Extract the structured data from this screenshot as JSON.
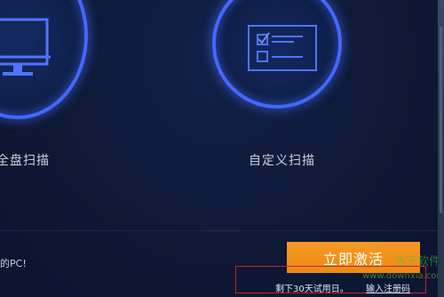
{
  "scan_options": [
    {
      "label": "全盘扫描",
      "icon": "monitor-icon"
    },
    {
      "label": "自定义扫描",
      "icon": "checklist-icon"
    }
  ],
  "footer": {
    "protect_text": "的PC!",
    "activate_button_label": "立即激活",
    "trial_text": "剩下30天试用日。",
    "register_link_label": "输入注册码"
  },
  "watermark": {
    "logo_text": "当下软件园",
    "url_text": "www.downxia.com"
  },
  "colors": {
    "background": "#0f1a33",
    "ring_glow": "#4468ff",
    "button_orange": "#f39a24",
    "highlight_border": "#c8202a",
    "text_light": "#c9d0dc"
  }
}
